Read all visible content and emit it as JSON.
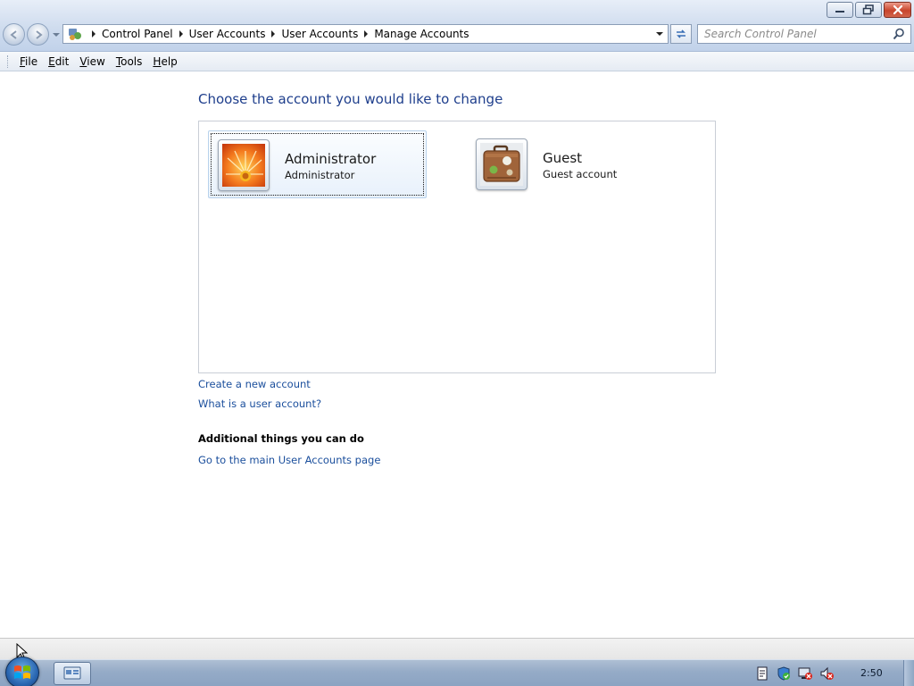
{
  "window": {
    "buttons": {
      "minimize": "minimize",
      "restore": "restore",
      "close": "close"
    }
  },
  "address_bar": {
    "breadcrumbs": [
      "Control Panel",
      "User Accounts",
      "User Accounts",
      "Manage Accounts"
    ]
  },
  "search": {
    "placeholder": "Search Control Panel"
  },
  "menu": {
    "items": [
      {
        "access_key": "F",
        "rest": "ile"
      },
      {
        "access_key": "E",
        "rest": "dit"
      },
      {
        "access_key": "V",
        "rest": "iew"
      },
      {
        "access_key": "T",
        "rest": "ools"
      },
      {
        "access_key": "H",
        "rest": "elp"
      }
    ]
  },
  "main": {
    "title": "Choose the account you would like to change",
    "accounts": [
      {
        "name": "Administrator",
        "type": "Administrator",
        "picture": "orange-flower-icon",
        "selected": true
      },
      {
        "name": "Guest",
        "type": "Guest account",
        "picture": "suitcase-icon",
        "selected": false
      }
    ],
    "links": {
      "create": "Create a new account",
      "what_is": "What is a user account?"
    },
    "additional": {
      "heading": "Additional things you can do",
      "main_page_link": "Go to the main User Accounts page"
    }
  },
  "taskbar": {
    "clock": "2:50",
    "tray_icons": [
      "document-icon",
      "security-shield-icon",
      "network-error-icon",
      "volume-muted-icon"
    ]
  },
  "colors": {
    "link": "#1a4e9c",
    "title": "#1e3e8c",
    "close_button": "#c8452c"
  }
}
